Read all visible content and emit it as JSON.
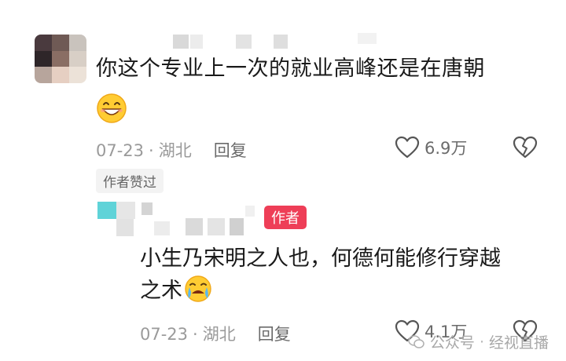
{
  "comment": {
    "text": "你这个专业上一次的就业高峰还是在唐朝",
    "emoji": "grinning-face-emoji",
    "date": "07-23",
    "separator": "·",
    "location": "湖北",
    "reply_label": "回复",
    "likes": "6.9万",
    "author_liked_label": "作者赞过"
  },
  "author_reply": {
    "badge": "作者",
    "text_line1": "小生乃宋明之人也，何德何能修行穿越",
    "text_line2": "之术",
    "emoji": "crying-face-emoji",
    "date": "07-23",
    "separator": "·",
    "location": "湖北",
    "reply_label": "回复",
    "likes": "4.1万"
  },
  "watermark": {
    "source": "公众号",
    "separator": "·",
    "name": "经视直播"
  },
  "colors": {
    "text": "#1a1a1a",
    "meta": "#9a9a9a",
    "author_badge": "#ee3e57"
  }
}
